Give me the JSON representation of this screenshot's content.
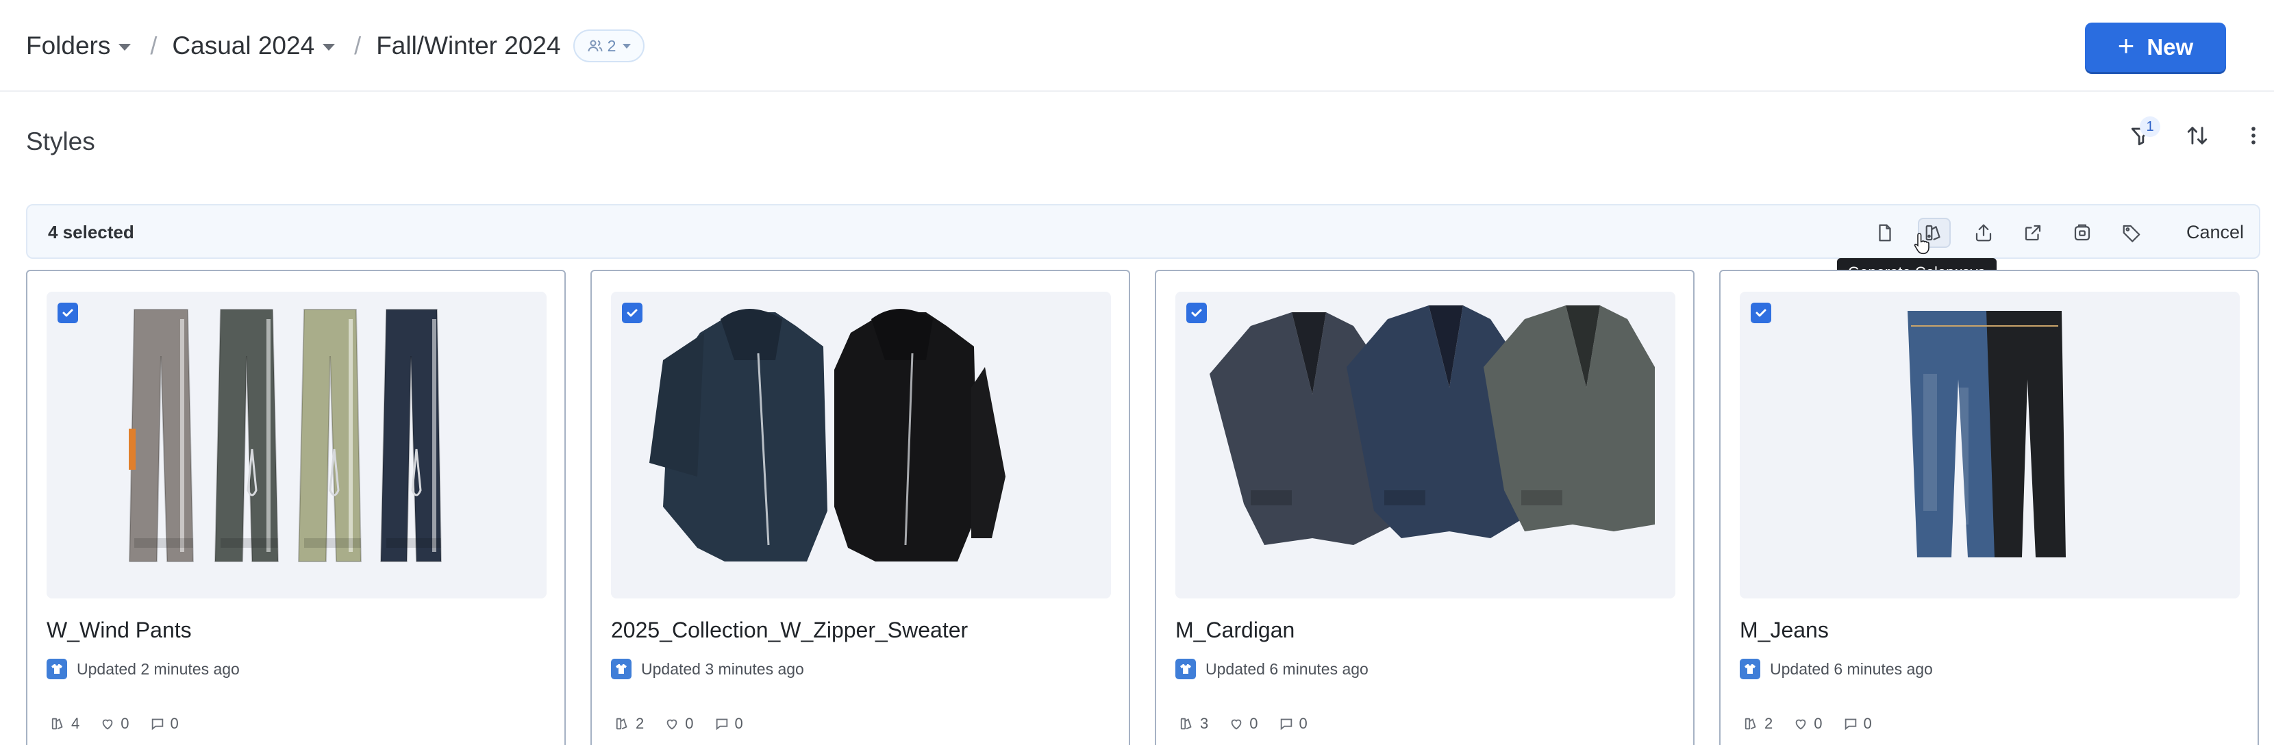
{
  "breadcrumb": {
    "items": [
      {
        "label": "Folders"
      },
      {
        "label": "Casual 2024"
      }
    ],
    "current": "Fall/Winter 2024",
    "share_count": "2"
  },
  "header": {
    "new_label": "New"
  },
  "section": {
    "title": "Styles",
    "filter_count": "1"
  },
  "selection": {
    "count_label": "4 selected",
    "cancel_label": "Cancel",
    "tooltip": "Generate Colorways"
  },
  "cards": [
    {
      "title": "W_Wind Pants",
      "updated": "Updated 2 minutes ago",
      "colorways": "4",
      "likes": "0",
      "comments": "0"
    },
    {
      "title": "2025_Collection_W_Zipper_Sweater",
      "updated": "Updated 3 minutes ago",
      "colorways": "2",
      "likes": "0",
      "comments": "0"
    },
    {
      "title": "M_Cardigan",
      "updated": "Updated 6 minutes ago",
      "colorways": "3",
      "likes": "0",
      "comments": "0"
    },
    {
      "title": "M_Jeans",
      "updated": "Updated 6 minutes ago",
      "colorways": "2",
      "likes": "0",
      "comments": "0"
    }
  ],
  "colors": {
    "accent": "#2a6de0",
    "card_border": "#a6b2c4",
    "selection_bg": "#f4f8fd"
  }
}
